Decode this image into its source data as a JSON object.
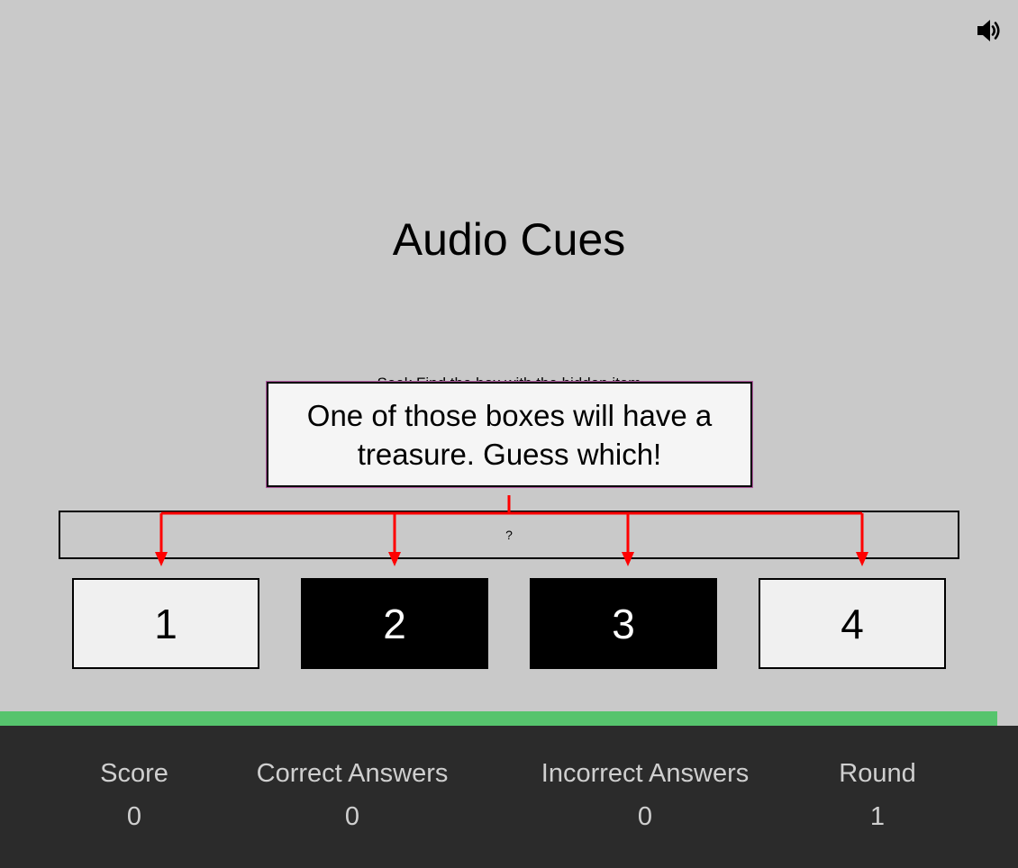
{
  "header": {
    "sound_icon": "speaker-volume-icon"
  },
  "game": {
    "title": "Audio Cues",
    "instruction": "Seek Find the box with the hidden item",
    "hint": "?",
    "tooltip": "One of those boxes will have a treasure. Guess which!",
    "boxes": [
      {
        "label": "1",
        "style": "light"
      },
      {
        "label": "2",
        "style": "dark"
      },
      {
        "label": "3",
        "style": "dark"
      },
      {
        "label": "4",
        "style": "light"
      }
    ],
    "arrow_color": "#ff0000",
    "progress": 0.98,
    "progress_color": "#56c46d"
  },
  "stats": {
    "score_label": "Score",
    "score_value": "0",
    "correct_label": "Correct Answers",
    "correct_value": "0",
    "incorrect_label": "Incorrect Answers",
    "incorrect_value": "0",
    "round_label": "Round",
    "round_value": "1"
  }
}
